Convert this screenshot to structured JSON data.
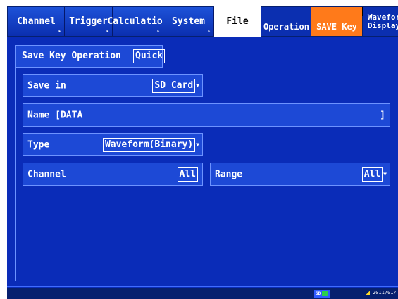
{
  "tabs": [
    {
      "label": "Channel"
    },
    {
      "label": "Trigger"
    },
    {
      "label": "Calculation"
    },
    {
      "label": "System"
    },
    {
      "label": "File"
    }
  ],
  "subtabs": {
    "operation": "Operation",
    "save_key": "SAVE Key",
    "waveform_line1": "Wavefor",
    "waveform_line2": "Display"
  },
  "section": {
    "title": "Save Key Operation",
    "mode": "Quick"
  },
  "fields": {
    "save_in": {
      "label": "Save in",
      "value": "SD Card"
    },
    "name": {
      "label": "Name [DATA",
      "close": "]"
    },
    "type": {
      "label": "Type",
      "value": "Waveform(Binary)"
    },
    "channel": {
      "label": "Channel",
      "value": "All"
    },
    "range": {
      "label": "Range",
      "value": "All"
    }
  },
  "status": {
    "storage": "SD",
    "date": "2011/01/"
  },
  "colors": {
    "background": "#0a2cb8",
    "field": "#1d49d6",
    "accent_save_key": "#ff7a1a"
  }
}
